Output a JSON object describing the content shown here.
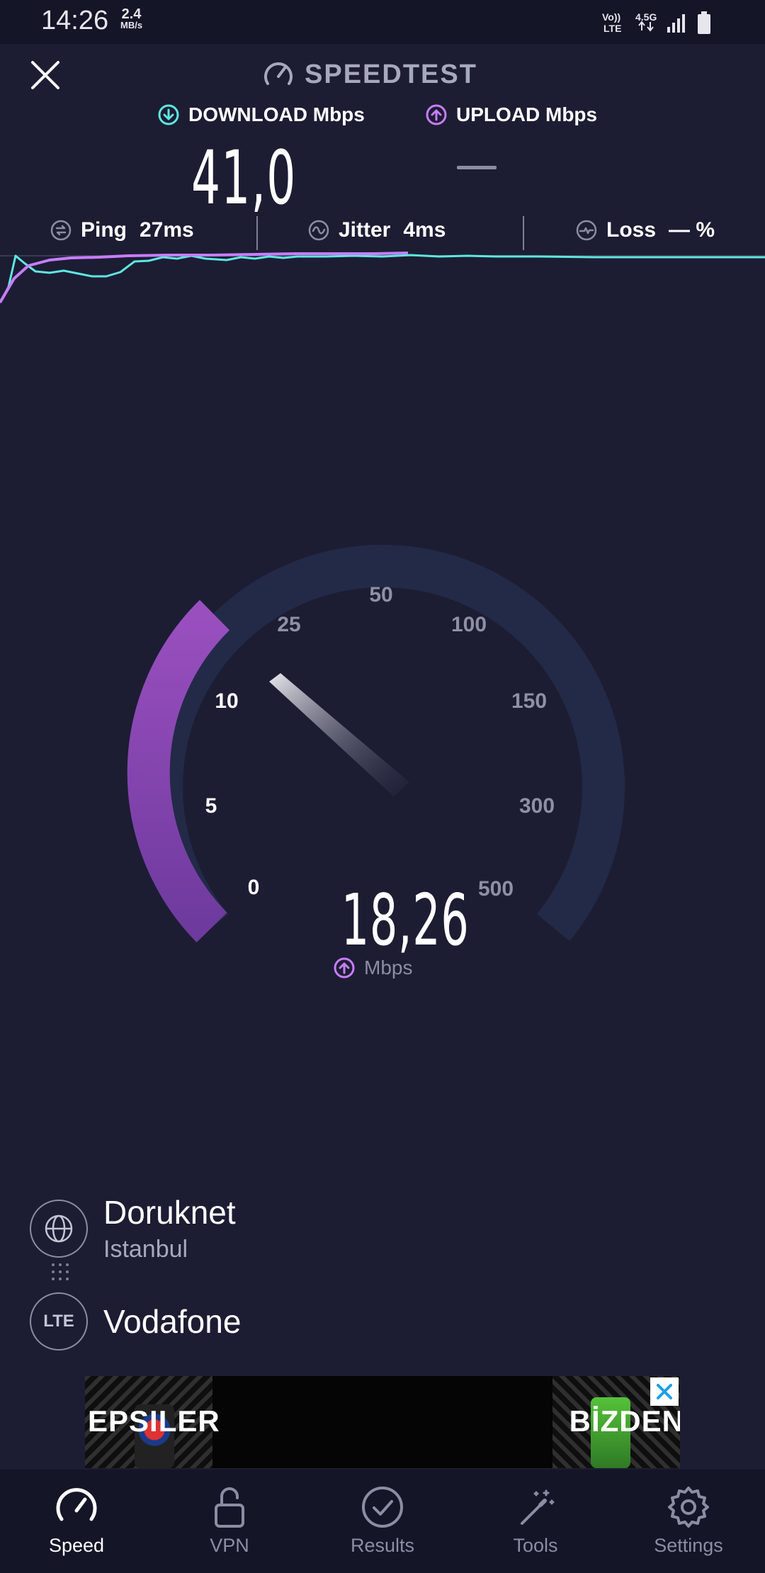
{
  "status_bar": {
    "time": "14:26",
    "speed_value": "2.4",
    "speed_unit": "MB/s",
    "volte": "Vo)) LTE",
    "network": "4.5G"
  },
  "header": {
    "title": "SPEEDTEST",
    "download_label": "DOWNLOAD Mbps",
    "upload_label": "UPLOAD Mbps",
    "download_value": "41,0",
    "upload_value": "—"
  },
  "stats": {
    "ping_label": "Ping",
    "ping_value": "27ms",
    "jitter_label": "Jitter",
    "jitter_value": "4ms",
    "loss_label": "Loss",
    "loss_value": "— %"
  },
  "gauge": {
    "tick_labels": [
      "0",
      "5",
      "10",
      "25",
      "50",
      "100",
      "150",
      "300",
      "500"
    ],
    "current_value": "18,26",
    "unit": "Mbps"
  },
  "server": {
    "provider": "Doruknet",
    "city": "Istanbul",
    "carrier_badge": "LTE",
    "carrier": "Vodafone"
  },
  "ad": {
    "left_text": "EPSILER",
    "right_text": "BİZDEN"
  },
  "nav": {
    "items": [
      {
        "label": "Speed",
        "icon": "speedometer-icon",
        "active": true
      },
      {
        "label": "VPN",
        "icon": "lock-open-icon",
        "active": false
      },
      {
        "label": "Results",
        "icon": "check-circle-icon",
        "active": false
      },
      {
        "label": "Tools",
        "icon": "magic-wand-icon",
        "active": false
      },
      {
        "label": "Settings",
        "icon": "gear-icon",
        "active": false
      }
    ]
  },
  "colors": {
    "background": "#1c1d33",
    "download_accent": "#5ee7e0",
    "upload_accent": "#c77dff",
    "gauge_track": "#232a47",
    "gauge_fill": "#8a45b8"
  }
}
